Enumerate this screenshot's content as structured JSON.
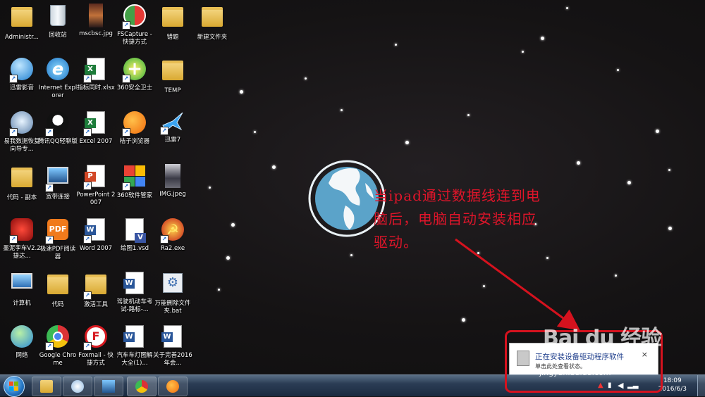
{
  "desktop_icons": [
    {
      "label": "Administr..."
    },
    {
      "label": "回收站"
    },
    {
      "label": "mscbsc.jpg"
    },
    {
      "label": "FSCapture - 快捷方式"
    },
    {
      "label": "错题"
    },
    {
      "label": "新建文件夹"
    },
    {
      "label": "迅雷影音"
    },
    {
      "label": "Internet Explorer"
    },
    {
      "label": "指标同时.xlsx"
    },
    {
      "label": "360安全卫士"
    },
    {
      "label": "TEMP"
    },
    {
      "label": "易我数据恢复向导专..."
    },
    {
      "label": "腾讯QQ轻聊版"
    },
    {
      "label": "Excel 2007"
    },
    {
      "label": "桔子浏览器"
    },
    {
      "label": "迅雷7"
    },
    {
      "label": "代码 - 副本"
    },
    {
      "label": "宽带连接"
    },
    {
      "label": "PowerPoint 2007"
    },
    {
      "label": "360软件管家"
    },
    {
      "label": "IMG.jpeg"
    },
    {
      "label": "墨泥孪车V2.2捷达..."
    },
    {
      "label": "极速PDF阅读器"
    },
    {
      "label": "Word 2007"
    },
    {
      "label": "绘图1.vsd"
    },
    {
      "label": "Ra2.exe"
    },
    {
      "label": "计算机"
    },
    {
      "label": "代码"
    },
    {
      "label": "激活工具"
    },
    {
      "label": "驾驶机动车考试-路标-..."
    },
    {
      "label": "万能删除文件夹.bat"
    },
    {
      "label": "网络"
    },
    {
      "label": "Google Chrome"
    },
    {
      "label": "Foxmail - 快捷方式"
    },
    {
      "label": "汽车车灯图解大全(1)..."
    },
    {
      "label": "关于完善2016年会..."
    }
  ],
  "annotation": {
    "line1": "当ipad通过数据线连到电",
    "line2": "脑后，电脑自动安装相应",
    "line3": "驱动。"
  },
  "notification": {
    "title": "正在安装设备驱动程序软件",
    "subtitle": "单击此处查看状态。",
    "close_glyph": "×"
  },
  "watermark": {
    "brand": "Bai du 经验",
    "url": "jingyan.baidu.com"
  },
  "taskbar": {
    "clock_time": "18:09",
    "clock_date": "2016/6/3",
    "pinned": [
      {
        "name": "windows-explorer"
      },
      {
        "name": "paint"
      },
      {
        "name": "network-app"
      },
      {
        "name": "google-chrome"
      },
      {
        "name": "orange-browser"
      }
    ]
  },
  "colors": {
    "annotation_red": "#e0152a",
    "highlight_red": "#d5121e",
    "globe_blue": "#5ba3c9",
    "taskbar": "#2b3d55"
  }
}
